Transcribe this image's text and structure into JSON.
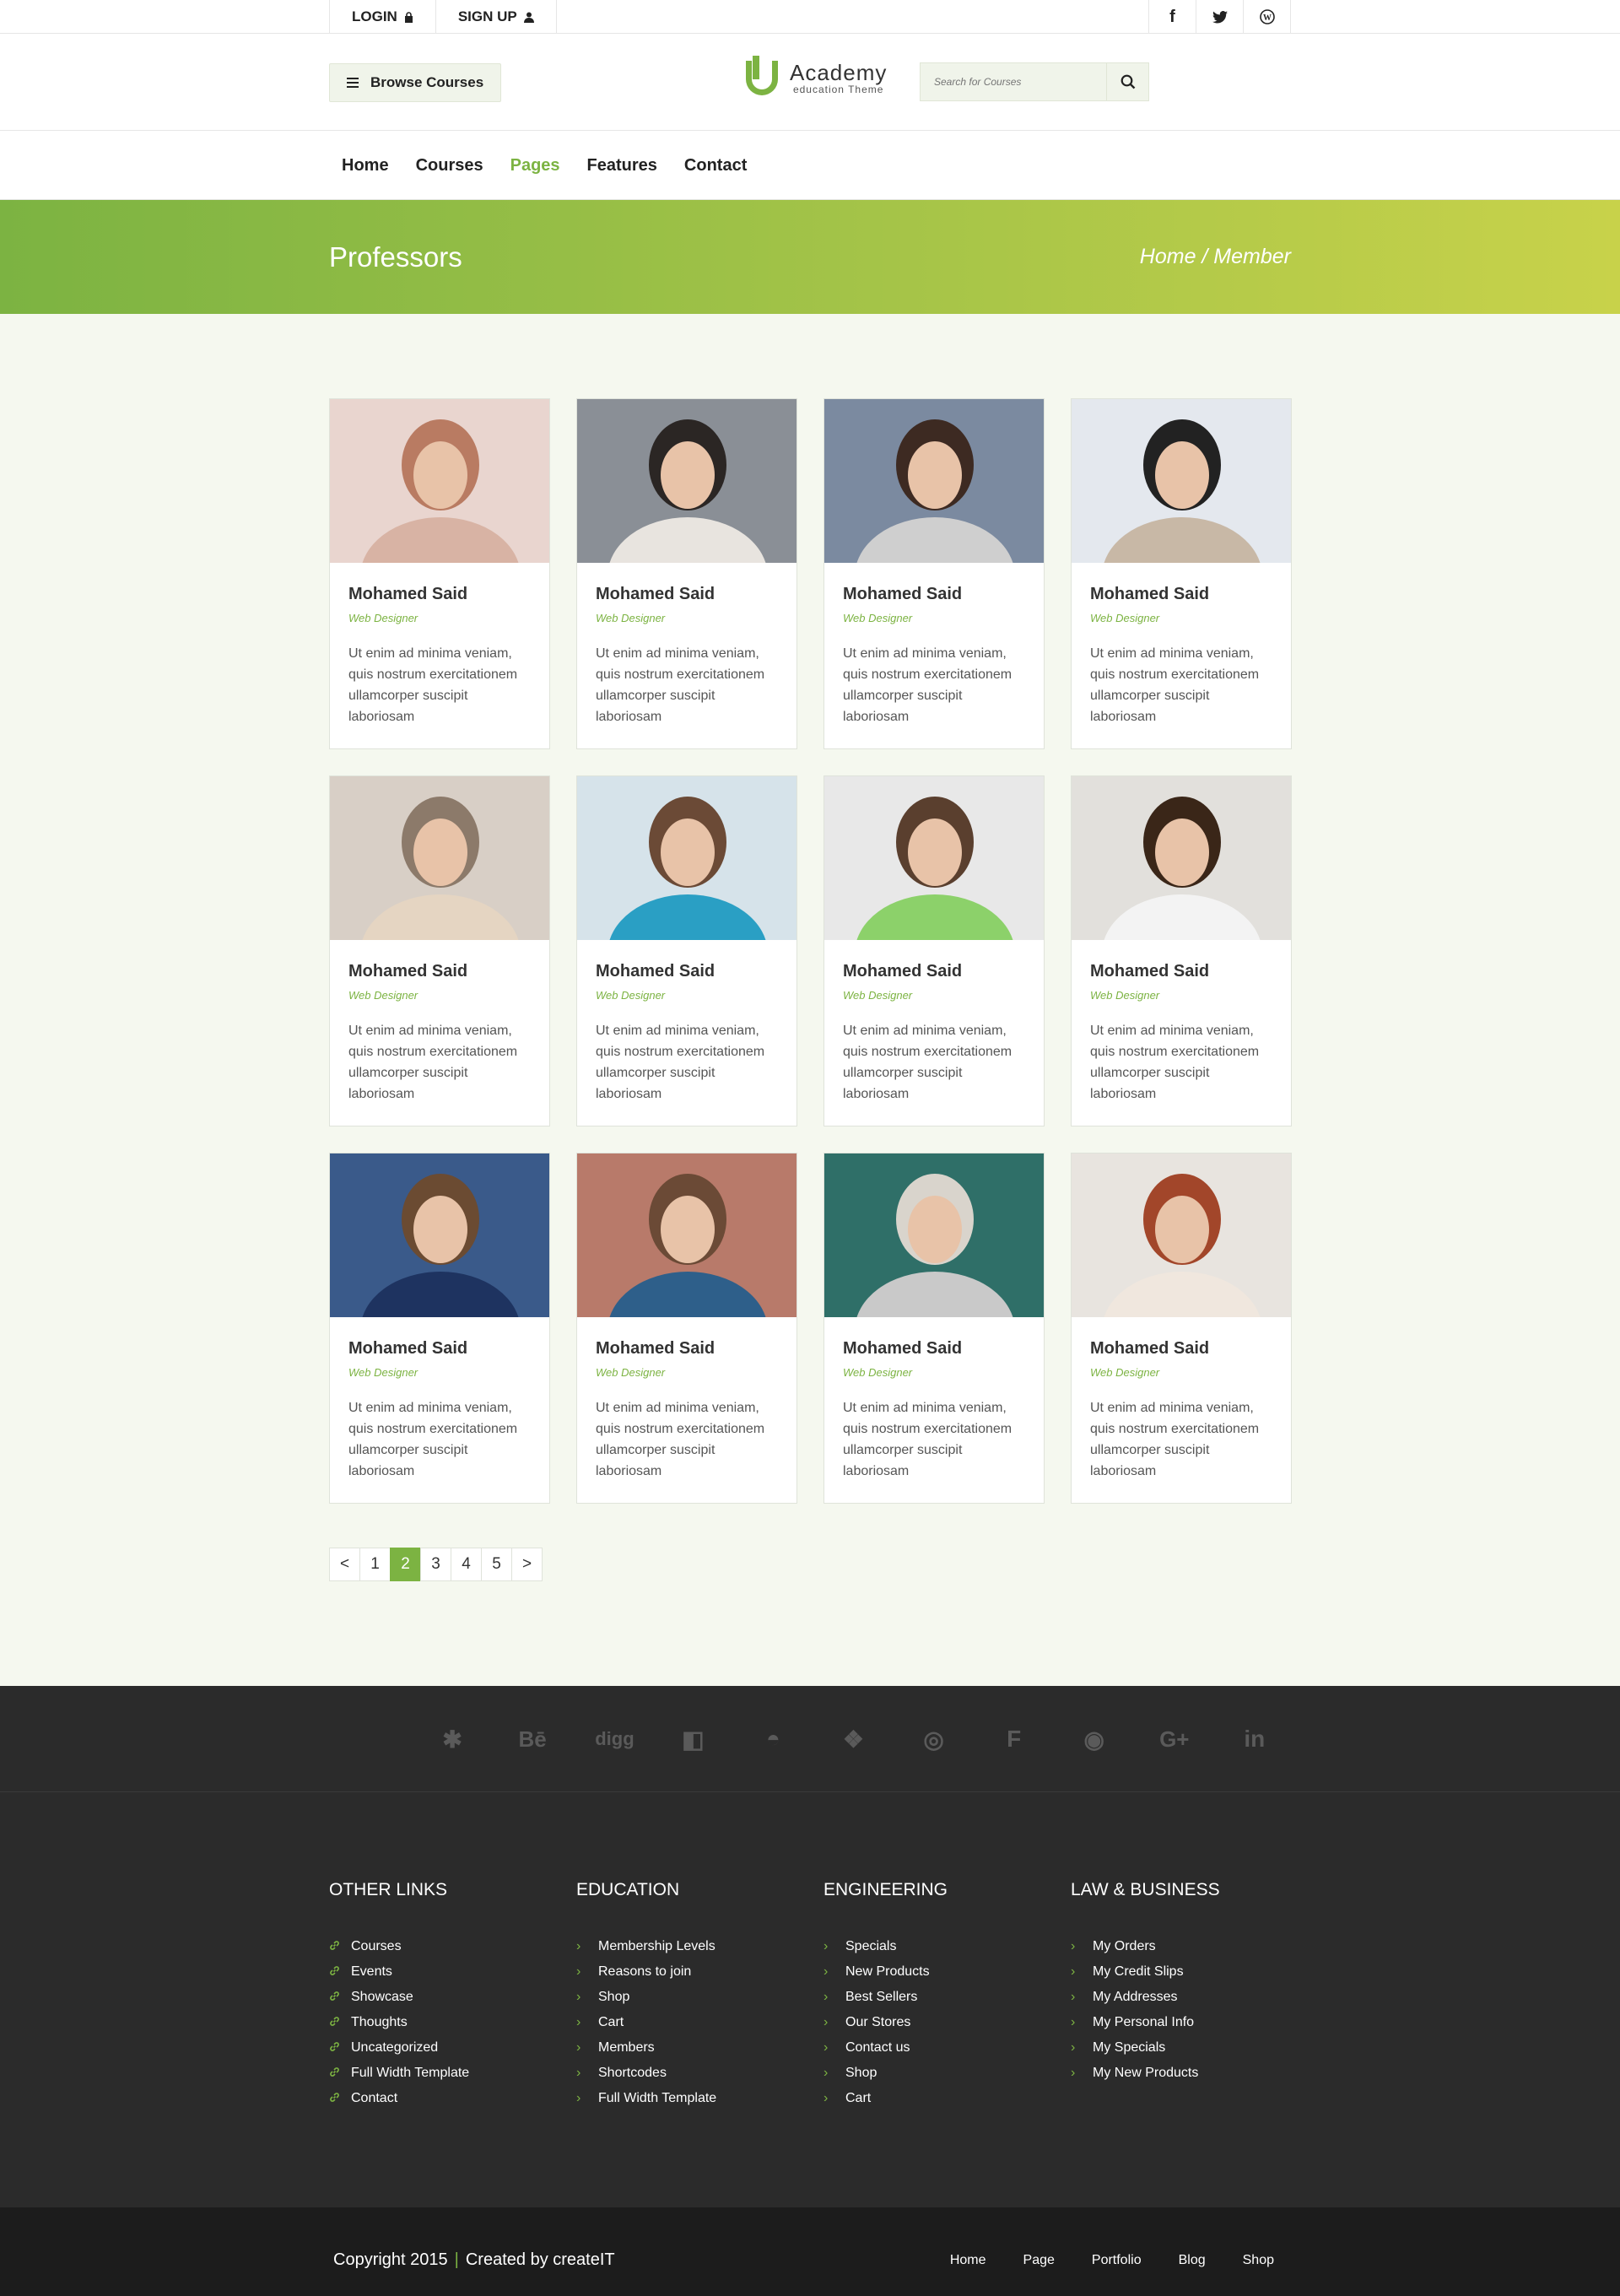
{
  "topbar": {
    "login": "LOGIN",
    "signup": "SIGN UP",
    "social": [
      "f",
      "t",
      "W"
    ]
  },
  "header": {
    "browse": "Browse Courses",
    "logo_title": "Academy",
    "logo_sub": "education Theme",
    "search_placeholder": "Search for Courses"
  },
  "nav": {
    "items": [
      "Home",
      "Courses",
      "Pages",
      "Features",
      "Contact"
    ],
    "active": "Pages"
  },
  "banner": {
    "title": "Professors",
    "breadcrumb": "Home / Member"
  },
  "professors": [
    {
      "name": "Mohamed Said",
      "role": "Web Designer",
      "desc": "Ut enim ad minima veniam, quis nostrum exercitationem ullamcorper suscipit laboriosam"
    },
    {
      "name": "Mohamed Said",
      "role": "Web Designer",
      "desc": "Ut enim ad minima veniam, quis nostrum exercitationem ullamcorper suscipit laboriosam"
    },
    {
      "name": "Mohamed Said",
      "role": "Web Designer",
      "desc": "Ut enim ad minima veniam, quis nostrum exercitationem ullamcorper suscipit laboriosam"
    },
    {
      "name": "Mohamed Said",
      "role": "Web Designer",
      "desc": "Ut enim ad minima veniam, quis nostrum exercitationem ullamcorper suscipit laboriosam"
    },
    {
      "name": "Mohamed Said",
      "role": "Web Designer",
      "desc": "Ut enim ad minima veniam, quis nostrum exercitationem ullamcorper suscipit laboriosam"
    },
    {
      "name": "Mohamed Said",
      "role": "Web Designer",
      "desc": "Ut enim ad minima veniam, quis nostrum exercitationem ullamcorper suscipit laboriosam"
    },
    {
      "name": "Mohamed Said",
      "role": "Web Designer",
      "desc": "Ut enim ad minima veniam, quis nostrum exercitationem ullamcorper suscipit laboriosam"
    },
    {
      "name": "Mohamed Said",
      "role": "Web Designer",
      "desc": "Ut enim ad minima veniam, quis nostrum exercitationem ullamcorper suscipit laboriosam"
    },
    {
      "name": "Mohamed Said",
      "role": "Web Designer",
      "desc": "Ut enim ad minima veniam, quis nostrum exercitationem ullamcorper suscipit laboriosam"
    },
    {
      "name": "Mohamed Said",
      "role": "Web Designer",
      "desc": "Ut enim ad minima veniam, quis nostrum exercitationem ullamcorper suscipit laboriosam"
    },
    {
      "name": "Mohamed Said",
      "role": "Web Designer",
      "desc": "Ut enim ad minima veniam, quis nostrum exercitationem ullamcorper suscipit laboriosam"
    },
    {
      "name": "Mohamed Said",
      "role": "Web Designer",
      "desc": "Ut enim ad minima veniam, quis nostrum exercitationem ullamcorper suscipit laboriosam"
    }
  ],
  "pagination": {
    "prev": "<",
    "pages": [
      "1",
      "2",
      "3",
      "4",
      "5"
    ],
    "current": "2",
    "next": ">"
  },
  "social_strip": [
    "apple-icon",
    "yelp-icon",
    "behance-icon",
    "digg-icon",
    "delicious-icon",
    "drupal-icon",
    "dropbox-icon",
    "dribbble-icon",
    "foursquare-icon",
    "github-icon",
    "google-plus-icon",
    "linkedin-icon"
  ],
  "social_glyphs": [
    "",
    "✱",
    "Bē",
    "digg",
    "◧",
    "◓",
    "❖",
    "◎",
    "F",
    "◉",
    "G+",
    "in"
  ],
  "footer": {
    "columns": [
      {
        "title": "OTHER LINKS",
        "icon": "link-icon",
        "items": [
          "Courses",
          "Events",
          "Showcase",
          "Thoughts",
          "Uncategorized",
          "Full Width Template",
          "Contact"
        ]
      },
      {
        "title": "EDUCATION",
        "icon": "chevron-right-icon",
        "items": [
          "Membership Levels",
          "Reasons to join",
          "Shop",
          "Cart",
          "Members",
          "Shortcodes",
          "Full Width Template"
        ]
      },
      {
        "title": "ENGINEERING",
        "icon": "chevron-right-icon",
        "items": [
          "Specials",
          "New Products",
          "Best Sellers",
          "Our Stores",
          "Contact us",
          "Shop",
          "Cart"
        ]
      },
      {
        "title": "LAW & BUSINESS",
        "icon": "chevron-right-icon",
        "items": [
          "My Orders",
          "My Credit Slips",
          "My Addresses",
          "My Personal Info",
          "My Specials",
          "My New Products"
        ]
      }
    ]
  },
  "bottom": {
    "copyright": "Copyright 2015",
    "separator": "|",
    "created": "Created by createIT",
    "links": [
      "Home",
      "Page",
      "Portfolio",
      "Blog",
      "Shop"
    ]
  },
  "colors": {
    "accent": "#7cb342",
    "footer_bg": "#2b2b2b",
    "bottom_bg": "#1c1c1c"
  }
}
